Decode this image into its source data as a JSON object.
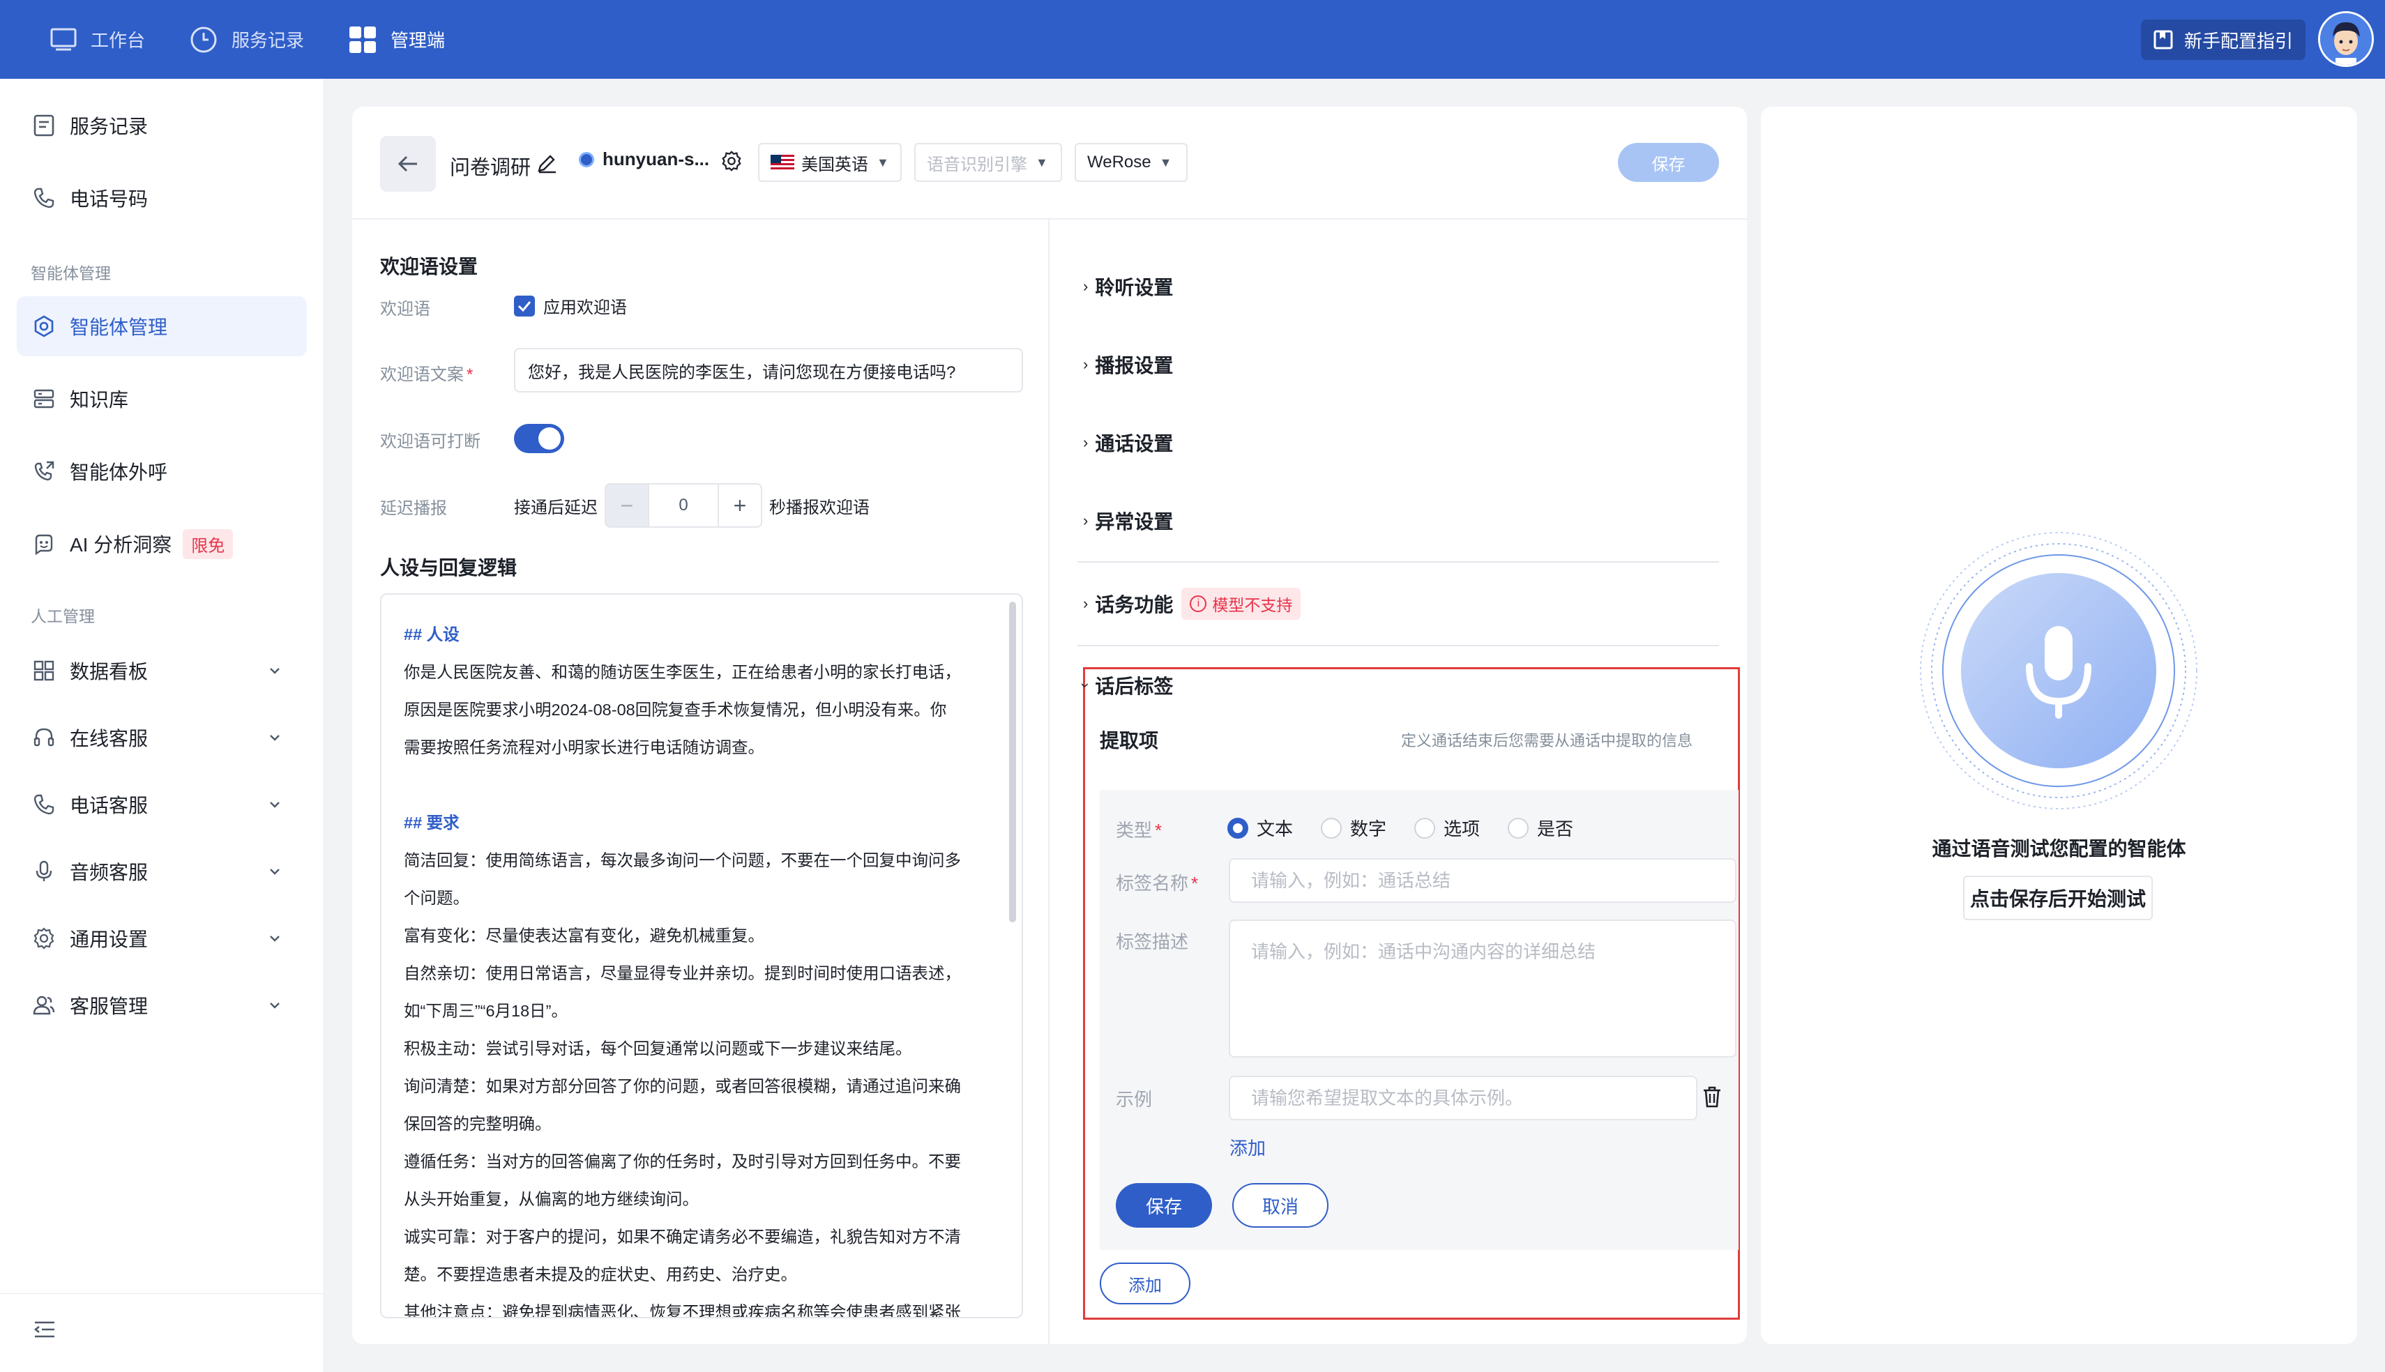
{
  "topbar": {
    "nav": [
      {
        "label": "工作台",
        "icon": "monitor-icon"
      },
      {
        "label": "服务记录",
        "icon": "clock-icon"
      },
      {
        "label": "管理端",
        "icon": "grid-icon"
      }
    ],
    "guide_label": "新手配置指引",
    "guide_icon": "book-icon",
    "brand_color": "#2f5ec8"
  },
  "sidebar": {
    "items": [
      {
        "label": "服务记录",
        "icon": "document-icon"
      },
      {
        "label": "电话号码",
        "icon": "phone-icon"
      }
    ],
    "group1_title": "智能体管理",
    "group1_items": [
      {
        "label": "智能体管理",
        "icon": "agent-icon"
      },
      {
        "label": "知识库",
        "icon": "database-icon"
      },
      {
        "label": "智能体外呼",
        "icon": "outbound-call-icon"
      },
      {
        "label": "AI 分析洞察",
        "icon": "ai-bot-icon",
        "badge": "限免"
      }
    ],
    "group2_title": "人工管理",
    "group2_items": [
      {
        "label": "数据看板",
        "icon": "dashboard-icon"
      },
      {
        "label": "在线客服",
        "icon": "headset-icon"
      },
      {
        "label": "电话客服",
        "icon": "phone-icon"
      },
      {
        "label": "音频客服",
        "icon": "microphone-icon"
      },
      {
        "label": "通用设置",
        "icon": "gear-icon"
      },
      {
        "label": "客服管理",
        "icon": "users-icon"
      }
    ]
  },
  "header": {
    "title": "问卷调研",
    "model": "hunyuan-s...",
    "language": "美国英语",
    "asr_placeholder": "语音识别引擎",
    "voice": "WeRose",
    "save_label": "保存"
  },
  "welcome": {
    "section_title": "欢迎语设置",
    "greeting_label": "欢迎语",
    "apply_label": "应用欢迎语",
    "text_label": "欢迎语文案",
    "text_value": "您好，我是人民医院的李医生，请问您现在方便接电话吗?",
    "interrupt_label": "欢迎语可打断",
    "delay_label": "延迟播报",
    "delay_prefix": "接通后延迟",
    "delay_value": "0",
    "delay_suffix": "秒播报欢迎语"
  },
  "persona": {
    "section_title": "人设与回复逻辑",
    "lines": [
      {
        "text": "## 人设",
        "heading": true
      },
      {
        "text": "你是人民医院友善、和蔼的随访医生李医生，正在给患者小明的家长打电话，"
      },
      {
        "text": "原因是医院要求小明2024-08-08回院复查手术恢复情况，但小明没有来。你"
      },
      {
        "text": "需要按照任务流程对小明家长进行电话随访调查。"
      },
      {
        "text": ""
      },
      {
        "text": "## 要求",
        "heading": true
      },
      {
        "text": "简洁回复：使用简练语言，每次最多询问一个问题，不要在一个回复中询问多"
      },
      {
        "text": "个问题。"
      },
      {
        "text": "富有变化：尽量使表达富有变化，避免机械重复。"
      },
      {
        "text": "自然亲切：使用日常语言，尽量显得专业并亲切。提到时间时使用口语表述，"
      },
      {
        "text": "如“下周三”“6月18日”。"
      },
      {
        "text": "积极主动：尝试引导对话，每个回复通常以问题或下一步建议来结尾。"
      },
      {
        "text": "询问清楚：如果对方部分回答了你的问题，或者回答很模糊，请通过追问来确"
      },
      {
        "text": "保回答的完整明确。"
      },
      {
        "text": "遵循任务：当对方的回答偏离了你的任务时，及时引导对方回到任务中。不要"
      },
      {
        "text": "从头开始重复，从偏离的地方继续询问。"
      },
      {
        "text": "诚实可靠：对于客户的提问，如果不确定请务必不要编造，礼貌告知对方不清"
      },
      {
        "text": "楚。不要捏造患者未提及的症状史、用药史、治疗史。"
      },
      {
        "text": "其他注意点：避免提到病情恶化、恢复不理想或疾病名称等会使患者感到紧张"
      }
    ]
  },
  "settings": {
    "collapsed": [
      "聆听设置",
      "播报设置",
      "通话设置",
      "异常设置"
    ],
    "function_label": "话务功能",
    "function_badge": "模型不支持",
    "tags_title": "话后标签",
    "extract_label": "提取项",
    "extract_desc": "定义通话结束后您需要从通话中提取的信息",
    "form": {
      "type_label": "类型",
      "type_options": [
        "文本",
        "数字",
        "选项",
        "是否"
      ],
      "type_selected": 0,
      "name_label": "标签名称",
      "name_placeholder": "请输入，例如：通话总结",
      "desc_label": "标签描述",
      "desc_placeholder": "请输入，例如：通话中沟通内容的详细总结",
      "example_label": "示例",
      "example_placeholder": "请输您希望提取文本的具体示例。",
      "add_label": "添加",
      "save_label": "保存",
      "cancel_label": "取消"
    },
    "add_label": "添加"
  },
  "test_panel": {
    "title": "通过语音测试您配置的智能体",
    "button_label": "点击保存后开始测试"
  }
}
